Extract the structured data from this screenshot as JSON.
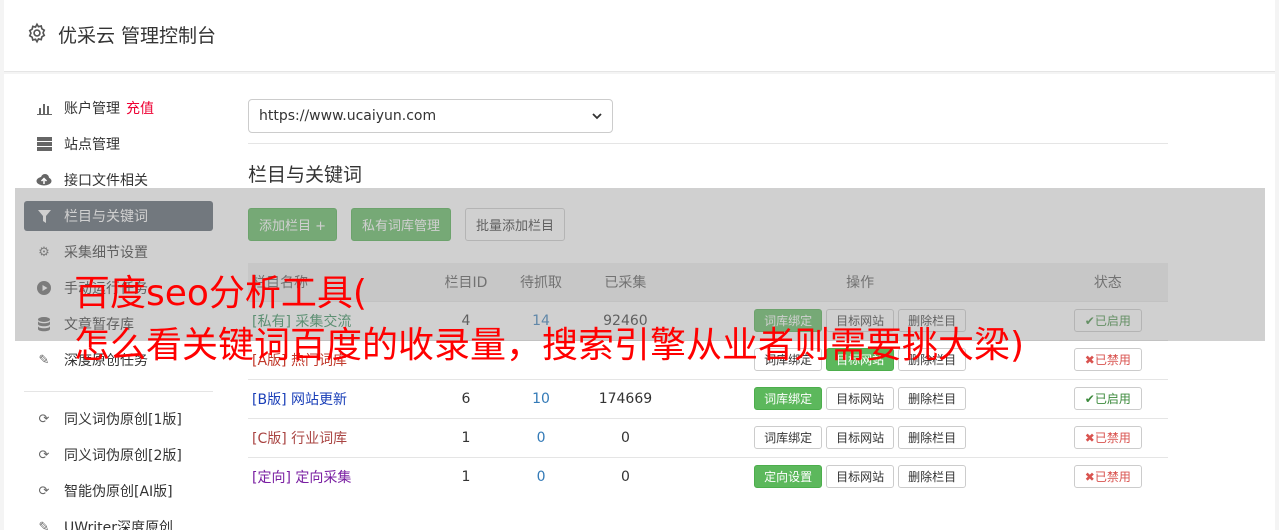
{
  "header": {
    "title": "优采云 管理控制台",
    "icon": "gear-icon"
  },
  "sidebar": {
    "items": [
      {
        "label": "账户管理",
        "badge": "充值",
        "icon": "bar-chart-icon"
      },
      {
        "label": "站点管理",
        "icon": "server-icon"
      },
      {
        "label": "接口文件相关",
        "icon": "cloud-upload-icon"
      },
      {
        "label": "栏目与关键词",
        "icon": "filter-icon",
        "active": true
      },
      {
        "label": "采集细节设置",
        "icon": "cogs-icon"
      },
      {
        "label": "手动运行任务",
        "icon": "play-icon"
      },
      {
        "label": "文章暂存库",
        "icon": "database-icon"
      },
      {
        "label": "深度原创任务",
        "icon": "edit-icon"
      }
    ],
    "items2": [
      {
        "label": "同义词伪原创[1版]",
        "icon": "refresh-icon"
      },
      {
        "label": "同义词伪原创[2版]",
        "icon": "refresh-icon"
      },
      {
        "label": "智能伪原创[AI版]",
        "icon": "refresh-icon"
      },
      {
        "label": "UWriter深度原创",
        "icon": "edit-icon"
      }
    ]
  },
  "main": {
    "site_select": "https://www.ucaiyun.com",
    "section_title": "栏目与关键词",
    "buttons": {
      "add": "添加栏目 +",
      "private_lib": "私有词库管理",
      "batch_add": "批量添加栏目"
    },
    "table": {
      "headers": [
        "栏目名称",
        "栏目ID",
        "待抓取",
        "已采集",
        "操作",
        "状态"
      ],
      "rows": [
        {
          "tag": "[私有]",
          "name": "采集交流",
          "id": "4",
          "pending": "14",
          "collected": "92460",
          "op1": "词库绑定",
          "op2": "目标网站",
          "op3": "删除栏目",
          "status": "✔已启用"
        },
        {
          "tag": "[A版]",
          "name": "热门词库",
          "id": "",
          "pending": "",
          "collected": "",
          "op1": "词库绑定",
          "op2": "目标网站",
          "op3": "删除栏目",
          "status": "✖已禁用"
        },
        {
          "tag": "[B版]",
          "name": "网站更新",
          "id": "6",
          "pending": "10",
          "collected": "174669",
          "op1": "词库绑定",
          "op2": "目标网站",
          "op3": "删除栏目",
          "status": "✔已启用"
        },
        {
          "tag": "[C版]",
          "name": "行业词库",
          "id": "1",
          "pending": "0",
          "collected": "0",
          "op1": "词库绑定",
          "op2": "目标网站",
          "op3": "删除栏目",
          "status": "✖已禁用"
        },
        {
          "tag": "[定向]",
          "name": "定向采集",
          "id": "1",
          "pending": "0",
          "collected": "0",
          "op1": "定向设置",
          "op2": "目标网站",
          "op3": "删除栏目",
          "status": "✖已禁用"
        }
      ]
    }
  },
  "overlay": {
    "line1": "百度seo分析工具(",
    "line2": "怎么看关键词百度的收录量，搜索引擎从业者则需要挑大梁)"
  },
  "colors": {
    "accent_green": "#5cb85c",
    "headline_red": "#ff0000",
    "sidebar_active": "#555f6a"
  }
}
